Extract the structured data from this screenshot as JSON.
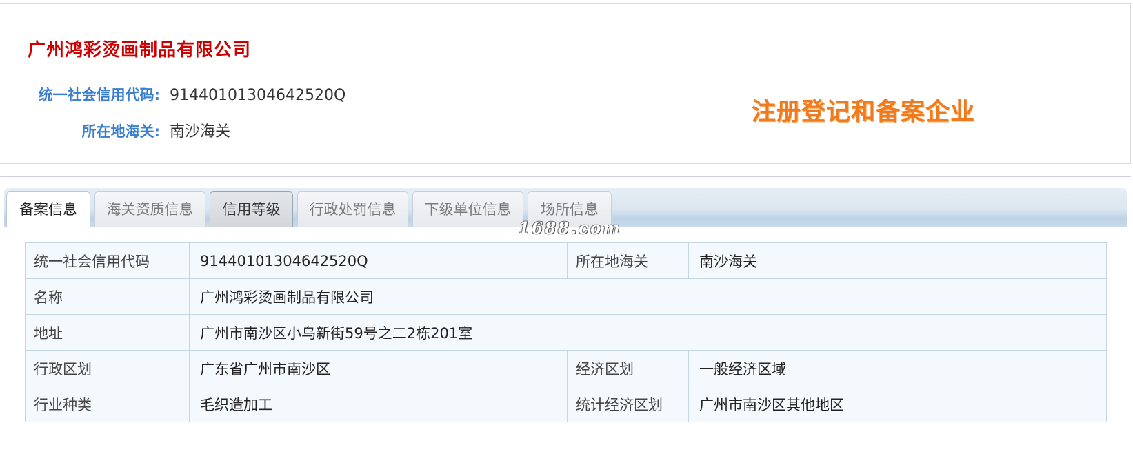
{
  "header": {
    "company_name": "广州鸿彩烫画制品有限公司",
    "credit_code_label": "统一社会信用代码:",
    "credit_code_value": "91440101304642520Q",
    "customs_label": "所在地海关:",
    "customs_value": "南沙海关",
    "stamp_text": "注册登记和备案企业"
  },
  "tabs": [
    {
      "label": "备案信息",
      "state": "active"
    },
    {
      "label": "海关资质信息",
      "state": "normal"
    },
    {
      "label": "信用等级",
      "state": "highlight"
    },
    {
      "label": "行政处罚信息",
      "state": "normal"
    },
    {
      "label": "下级单位信息",
      "state": "normal"
    },
    {
      "label": "场所信息",
      "state": "normal"
    }
  ],
  "watermark": "1688.com",
  "table": {
    "rows": [
      {
        "label1": "统一社会信用代码",
        "value1": "91440101304642520Q",
        "label2": "所在地海关",
        "value2": "南沙海关"
      },
      {
        "label1": "名称",
        "value1": "广州鸿彩烫画制品有限公司"
      },
      {
        "label1": "地址",
        "value1": "广州市南沙区小乌新街59号之二2栋201室"
      },
      {
        "label1": "行政区划",
        "value1": "广东省广州市南沙区",
        "label2": "经济区划",
        "value2": "一般经济区域"
      },
      {
        "label1": "行业种类",
        "value1": "毛织造加工",
        "label2": "统计经济区划",
        "value2": "广州市南沙区其他地区"
      }
    ]
  },
  "colors": {
    "company_name": "#cc0000",
    "header_label": "#3a7fcf",
    "stamp": "#f07a1e",
    "table_border": "#c4d6e4",
    "table_bg": "#f4f9fd"
  }
}
